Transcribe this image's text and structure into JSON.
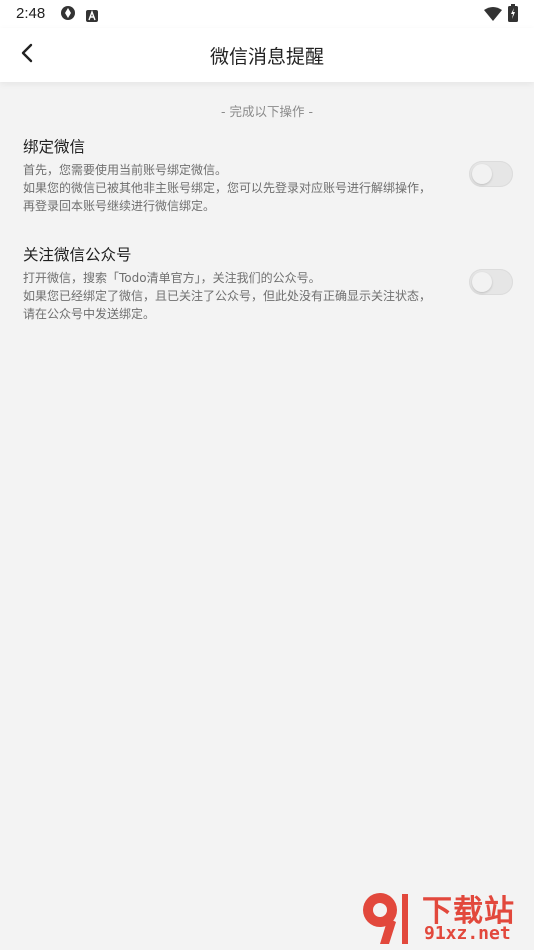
{
  "status_bar": {
    "time": "2:48",
    "icons_left": [
      "sync-icon",
      "a-badge-icon"
    ],
    "icons_right": [
      "wifi-icon",
      "battery-charging-icon"
    ]
  },
  "header": {
    "title": "微信消息提醒",
    "back_icon": "chevron-left-icon"
  },
  "section_hint": "- 完成以下操作 -",
  "settings": [
    {
      "title": "绑定微信",
      "desc_lines": [
        "首先，您需要使用当前账号绑定微信。",
        "如果您的微信已被其他非主账号绑定，您可以先登录对应账号进行解绑操作，再登录回本账号继续进行微信绑定。"
      ],
      "enabled": false
    },
    {
      "title": "关注微信公众号",
      "desc_lines": [
        "打开微信，搜索「Todo清单官方」，关注我们的公众号。",
        "如果您已经绑定了微信，且已关注了公众号，但此处没有正确显示关注状态，请在公众号中发送绑定。"
      ],
      "enabled": false
    }
  ],
  "watermark": {
    "top": "下载站",
    "bottom": "91xz.net"
  },
  "colors": {
    "background": "#f3f3f3",
    "bar_background": "#ffffff",
    "toggle_off": "#e6e6e6",
    "watermark_red": "#e2483c"
  }
}
